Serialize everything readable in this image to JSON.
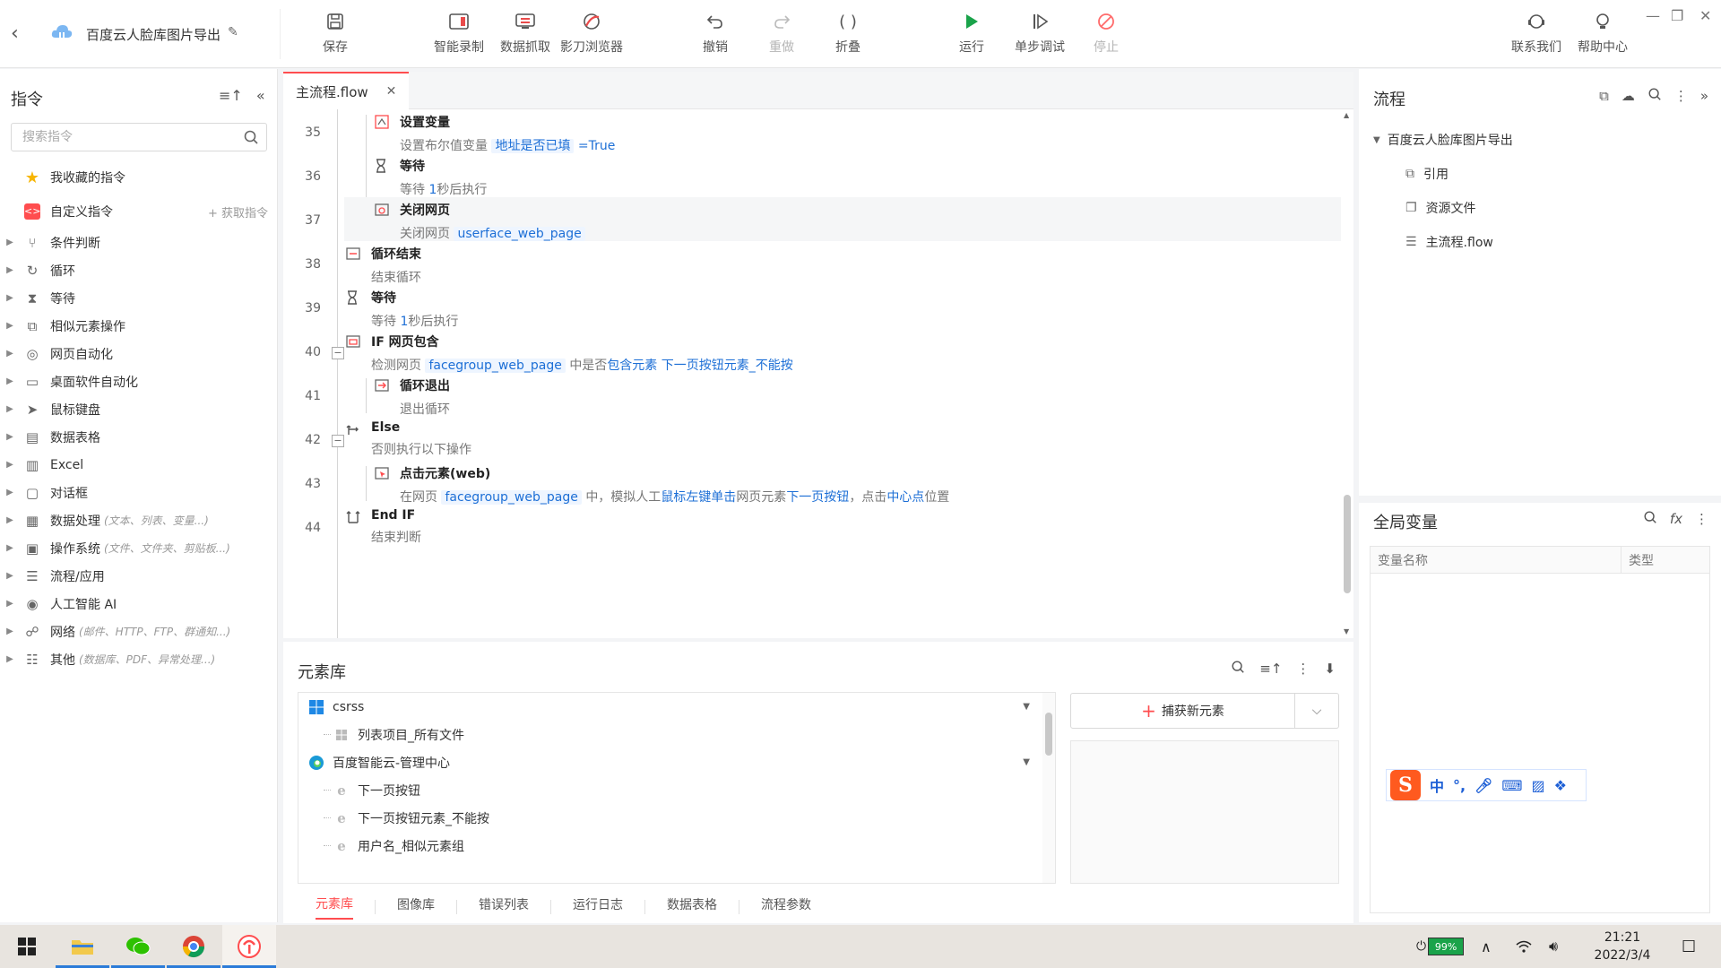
{
  "app": {
    "project_title": "百度云人脸库图片导出"
  },
  "toolbar": {
    "save": "保存",
    "smart_record": "智能录制",
    "data_capture": "数据抓取",
    "browser": "影刀浏览器",
    "undo": "撤销",
    "redo": "重做",
    "fold": "折叠",
    "run": "运行",
    "step_debug": "单步调试",
    "stop": "停止",
    "contact": "联系我们",
    "help": "帮助中心"
  },
  "left_panel": {
    "title": "指令",
    "search_placeholder": "搜索指令",
    "favorites": "我收藏的指令",
    "custom": "自定义指令",
    "get_command": "+ 获取指令",
    "categories": [
      {
        "label": "条件判断",
        "hint": "",
        "icon": "branch-icon"
      },
      {
        "label": "循环",
        "hint": "",
        "icon": "loop-icon"
      },
      {
        "label": "等待",
        "hint": "",
        "icon": "hourglass-icon"
      },
      {
        "label": "相似元素操作",
        "hint": "",
        "icon": "similar-icon"
      },
      {
        "label": "网页自动化",
        "hint": "",
        "icon": "globe-icon"
      },
      {
        "label": "桌面软件自动化",
        "hint": "",
        "icon": "desktop-icon"
      },
      {
        "label": "鼠标键盘",
        "hint": "",
        "icon": "cursor-icon"
      },
      {
        "label": "数据表格",
        "hint": "",
        "icon": "table-icon"
      },
      {
        "label": "Excel",
        "hint": "",
        "icon": "excel-icon"
      },
      {
        "label": "对话框",
        "hint": "",
        "icon": "dialog-icon"
      },
      {
        "label": "数据处理",
        "hint": "(文本、列表、变量...)",
        "icon": "data-icon"
      },
      {
        "label": "操作系统",
        "hint": "(文件、文件夹、剪贴板...)",
        "icon": "os-icon"
      },
      {
        "label": "流程/应用",
        "hint": "",
        "icon": "layers-icon"
      },
      {
        "label": "人工智能 AI",
        "hint": "",
        "icon": "ai-icon"
      },
      {
        "label": "网络",
        "hint": "(邮件、HTTP、FTP、群通知...)",
        "icon": "network-icon"
      },
      {
        "label": "其他",
        "hint": "(数据库、PDF、异常处理...)",
        "icon": "grid-icon"
      }
    ]
  },
  "editor": {
    "tab_label": "主流程.flow",
    "lines": [
      {
        "num": "35",
        "title": "设置变量",
        "desc_pre": "设置布尔值变量",
        "token": "地址是否已填",
        "desc_post": "=True"
      },
      {
        "num": "36",
        "title": "等待",
        "desc_pre": "等待",
        "num_tok": "1",
        "desc_post": "秒后执行"
      },
      {
        "num": "37",
        "title": "关闭网页",
        "desc_pre": "关闭网页",
        "token": "userface_web_page"
      },
      {
        "num": "38",
        "title": "循环结束",
        "desc": "结束循环"
      },
      {
        "num": "39",
        "title": "等待",
        "desc_pre": "等待",
        "num_tok": "1",
        "desc_post": "秒后执行"
      },
      {
        "num": "40",
        "title": "IF 网页包含",
        "desc_pre": "检测网页",
        "token": "facegroup_web_page",
        "mid1": "中是否",
        "lnk1": "包含元素",
        "lnk2": "下一页按钮元素_不能按"
      },
      {
        "num": "41",
        "title": "循环退出",
        "desc": "退出循环"
      },
      {
        "num": "42",
        "title": "Else",
        "desc": "否则执行以下操作"
      },
      {
        "num": "43",
        "title": "点击元素(web)",
        "desc_pre": "在网页",
        "token": "facegroup_web_page",
        "mid1": "中，模拟人工",
        "lnk1": "鼠标左键单击",
        "mid2": "网页元素",
        "lnk2": "下一页按钮",
        "mid3": "，点击",
        "lnk3": "中心点",
        "mid4": "位置"
      },
      {
        "num": "44",
        "title": "End IF",
        "desc": "结束判断"
      }
    ]
  },
  "element_library": {
    "title": "元素库",
    "capture_button": "捕获新元素",
    "tree": [
      {
        "label": "csrss",
        "level": 0,
        "icon": "windows-icon"
      },
      {
        "label": "列表项目_所有文件",
        "level": 1,
        "icon": "windows-small-icon"
      },
      {
        "label": "百度智能云-管理中心",
        "level": 0,
        "icon": "edge-icon"
      },
      {
        "label": "下一页按钮",
        "level": 1,
        "icon": "ie-icon"
      },
      {
        "label": "下一页按钮元素_不能按",
        "level": 1,
        "icon": "ie-icon"
      },
      {
        "label": "用户名_相似元素组",
        "level": 1,
        "icon": "ie-icon"
      }
    ],
    "bottom_tabs": [
      "元素库",
      "图像库",
      "错误列表",
      "运行日志",
      "数据表格",
      "流程参数"
    ]
  },
  "right_panel": {
    "flow_title": "流程",
    "tree_root": "百度云人脸库图片导出",
    "tree_items": [
      "引用",
      "资源文件",
      "主流程.flow"
    ],
    "vars_title": "全局变量",
    "col_name": "变量名称",
    "col_type": "类型"
  },
  "ime": {
    "zh": "中",
    "punct": "°,"
  },
  "taskbar": {
    "battery": "99%",
    "time": "21:21",
    "date": "2022/3/4"
  },
  "colors": {
    "accent": "#ff4d4f",
    "link": "#1d6fd6",
    "run": "#1aa34a",
    "stop": "#ff6b6b"
  }
}
